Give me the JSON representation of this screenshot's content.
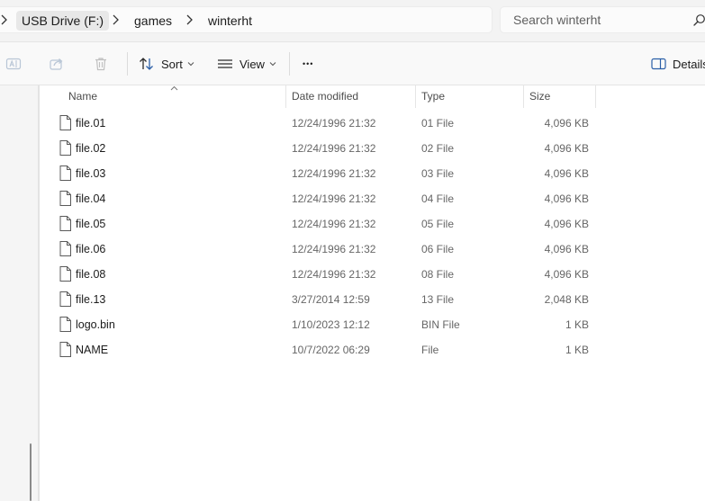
{
  "breadcrumb": {
    "items": [
      {
        "label": "USB Drive (F:)"
      },
      {
        "label": "games"
      },
      {
        "label": "winterht"
      }
    ]
  },
  "search": {
    "placeholder": "Search winterht"
  },
  "toolbar": {
    "sort_label": "Sort",
    "view_label": "View",
    "more_label": "•••",
    "details_label": "Details"
  },
  "columns": {
    "name": "Name",
    "date_modified": "Date modified",
    "type": "Type",
    "size": "Size"
  },
  "files": [
    {
      "name": "file.01",
      "date": "12/24/1996 21:32",
      "type": "01 File",
      "size": "4,096 KB"
    },
    {
      "name": "file.02",
      "date": "12/24/1996 21:32",
      "type": "02 File",
      "size": "4,096 KB"
    },
    {
      "name": "file.03",
      "date": "12/24/1996 21:32",
      "type": "03 File",
      "size": "4,096 KB"
    },
    {
      "name": "file.04",
      "date": "12/24/1996 21:32",
      "type": "04 File",
      "size": "4,096 KB"
    },
    {
      "name": "file.05",
      "date": "12/24/1996 21:32",
      "type": "05 File",
      "size": "4,096 KB"
    },
    {
      "name": "file.06",
      "date": "12/24/1996 21:32",
      "type": "06 File",
      "size": "4,096 KB"
    },
    {
      "name": "file.08",
      "date": "12/24/1996 21:32",
      "type": "08 File",
      "size": "4,096 KB"
    },
    {
      "name": "file.13",
      "date": "3/27/2014 12:59",
      "type": "13 File",
      "size": "2,048 KB"
    },
    {
      "name": "logo.bin",
      "date": "1/10/2023 12:12",
      "type": "BIN File",
      "size": "1 KB"
    },
    {
      "name": "NAME",
      "date": "10/7/2022 06:29",
      "type": "File",
      "size": "1 KB"
    }
  ],
  "icons": {
    "breadcrumb_separator": "chevron-right-icon",
    "search": "search-icon",
    "rename": "rename-icon",
    "share": "share-icon",
    "delete": "trash-icon",
    "sort": "sort-icon",
    "view": "view-list-icon",
    "more": "more-dots-icon",
    "details": "details-pane-icon",
    "file": "file-icon",
    "sort_direction": "chevron-up-icon"
  },
  "colors": {
    "address_bar_bg": "#f3f3f3",
    "command_bar_bg": "#f9f9f9",
    "nav_pane_bg": "#f5f5f5",
    "text_primary": "#1b1b1b",
    "text_secondary": "#666666"
  }
}
